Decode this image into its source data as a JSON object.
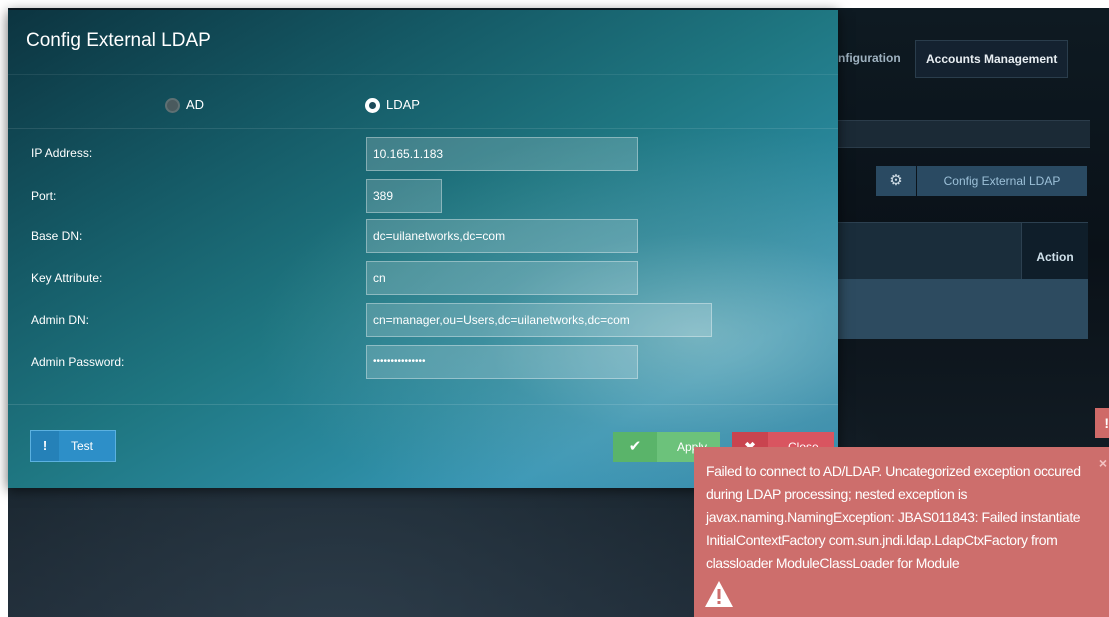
{
  "background": {
    "tabs": [
      {
        "label": "nfiguration"
      },
      {
        "label": "Accounts Management"
      }
    ],
    "config_button": {
      "icon": "gear-icon",
      "label": "Config External LDAP"
    },
    "table": {
      "action_header": "Action"
    }
  },
  "modal": {
    "title": "Config External LDAP",
    "server_type": {
      "options": [
        {
          "label": "AD",
          "selected": false
        },
        {
          "label": "LDAP",
          "selected": true
        }
      ]
    },
    "fields": {
      "ip_address": {
        "label": "IP Address:",
        "value": "10.165.1.183"
      },
      "port": {
        "label": "Port:",
        "value": "389"
      },
      "base_dn": {
        "label": "Base DN:",
        "value": "dc=uilanetworks,dc=com"
      },
      "key_attribute": {
        "label": "Key Attribute:",
        "value": "cn"
      },
      "admin_dn": {
        "label": "Admin DN:",
        "value": "cn=manager,ou=Users,dc=uilanetworks,dc=com"
      },
      "admin_password": {
        "label": "Admin Password:",
        "value": "•••••••••••••••"
      }
    },
    "buttons": {
      "test": {
        "icon": "!",
        "label": "Test"
      },
      "apply": {
        "icon": "✔",
        "label": "Apply"
      },
      "close": {
        "icon": "✖",
        "label": "Close"
      }
    }
  },
  "toast": {
    "message": "Failed to connect to AD/LDAP. Uncategorized exception occured during LDAP processing; nested exception is javax.naming.NamingException: JBAS011843: Failed instantiate InitialContextFactory com.sun.jndi.ldap.LdapCtxFactory from classloader ModuleClassLoader for Module",
    "close_icon": "×"
  },
  "colors": {
    "accent_blue": "#2d8fc8",
    "apply_green": "#6cc27b",
    "close_red": "#d95560",
    "error_toast": "#cd6e6c"
  }
}
